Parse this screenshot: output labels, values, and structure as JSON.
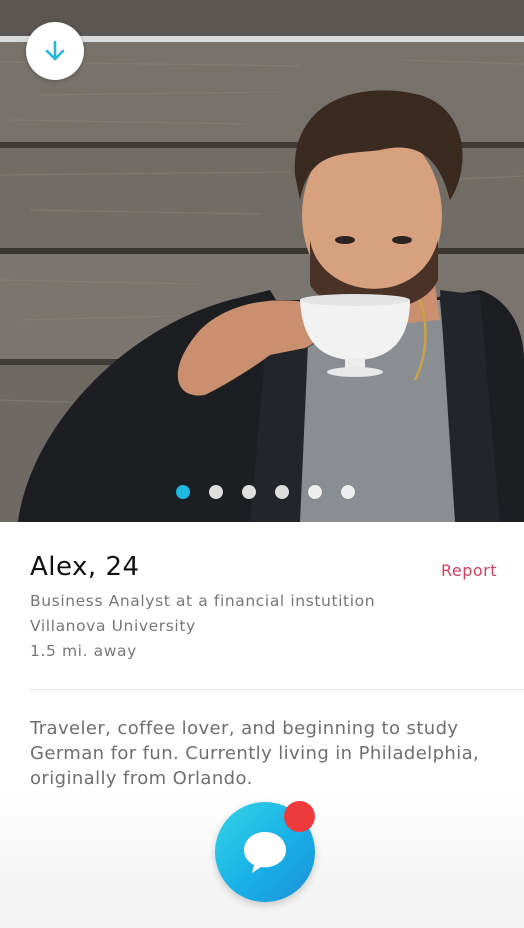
{
  "photo": {
    "collapse_icon": "arrow-down-icon",
    "accent_color": "#1fb8e0",
    "dots": [
      {
        "active": true
      },
      {
        "active": false
      },
      {
        "active": false
      },
      {
        "active": false
      },
      {
        "active": false
      },
      {
        "active": false
      }
    ]
  },
  "profile": {
    "name": "Alex, 24",
    "report_label": "Report",
    "report_color": "#d2405f",
    "job": "Business Analyst at a financial instutition",
    "school": "Villanova University",
    "distance": "1.5 mi. away",
    "bio": "Traveler, coffee lover, and beginning to study German for fun. Currently living in Philadelphia, originally from Orlando."
  },
  "actions": {
    "chat_icon": "chat-bubble-icon",
    "notification_color": "#ee3a3a"
  }
}
